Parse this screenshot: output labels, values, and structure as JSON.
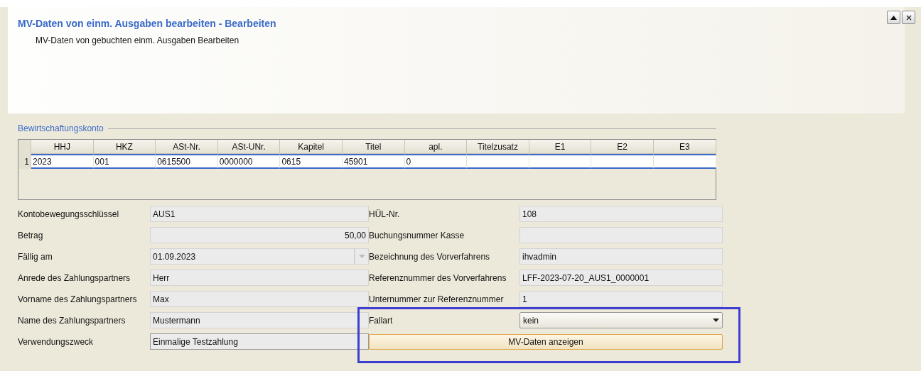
{
  "header": {
    "title": "MV-Daten von einm. Ausgaben bearbeiten - Bearbeiten",
    "subtitle": "MV-Daten von gebuchten einm. Ausgaben Bearbeiten"
  },
  "window_buttons": [
    {
      "kind": "collapse"
    },
    {
      "kind": "close"
    }
  ],
  "account": {
    "legend": "Bewirtschaftungskonto",
    "columns": [
      "HHJ",
      "HKZ",
      "ASt-Nr.",
      "ASt-UNr.",
      "Kapitel",
      "Titel",
      "apl.",
      "Titelzusatz",
      "E1",
      "E2",
      "E3"
    ],
    "rows": [
      {
        "number": "1",
        "selected": true,
        "cells": [
          "2023",
          "001",
          "0615500",
          "0000000",
          "0615",
          "45901",
          "0",
          "",
          "",
          "",
          ""
        ]
      }
    ]
  },
  "left_fields": [
    {
      "label": "Kontobewegungsschlüssel",
      "value": "AUS1",
      "kind": "text"
    },
    {
      "label": "Betrag",
      "value": "50,00",
      "kind": "number"
    },
    {
      "label": "Fällig am",
      "value": "01.09.2023",
      "kind": "date"
    },
    {
      "label": "Anrede des Zahlungspartners",
      "value": "Herr",
      "kind": "text"
    },
    {
      "label": "Vorname des Zahlungspartners",
      "value": "Max",
      "kind": "text"
    },
    {
      "label": "Name des Zahlungspartners",
      "value": "Mustermann",
      "kind": "text"
    },
    {
      "label": "Verwendungszweck",
      "value": "Einmalige Testzahlung",
      "kind": "editable"
    }
  ],
  "right_fields": [
    {
      "label": "HÜL-Nr.",
      "value": "108",
      "kind": "text"
    },
    {
      "label": "Buchungsnummer Kasse",
      "kind": "text"
    },
    {
      "label": "Bezeichnung des Vorverfahrens",
      "value": "ihvadmin",
      "kind": "text"
    },
    {
      "label": "Referenznummer des Vorverfahrens",
      "value": "LFF-2023-07-20_AUS1_0000001",
      "kind": "text"
    },
    {
      "label": "Unternummer zur Referenznummer",
      "value": "1",
      "kind": "text"
    },
    {
      "label": "Fallart",
      "value": "kein",
      "kind": "select"
    },
    {
      "label": "MV-Daten anzeigen",
      "kind": "button"
    }
  ],
  "highlight": {
    "shown": true
  }
}
